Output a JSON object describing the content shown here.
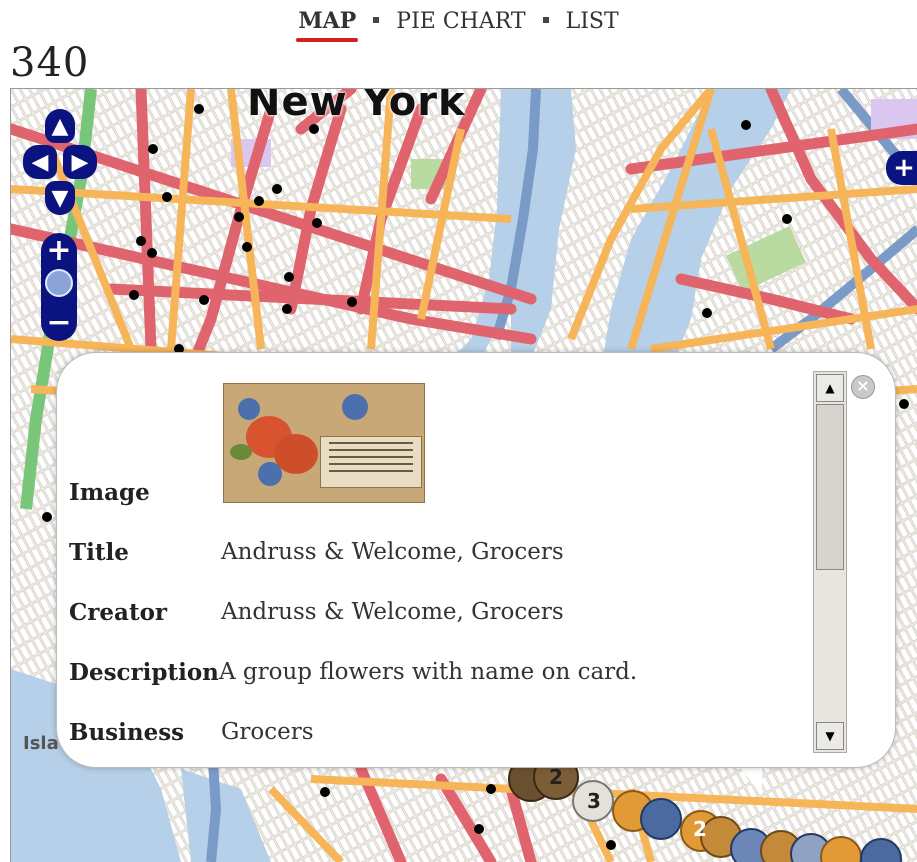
{
  "nav": {
    "items": [
      {
        "label": "MAP",
        "active": true
      },
      {
        "label": "PIE CHART",
        "active": false
      },
      {
        "label": "LIST",
        "active": false
      }
    ]
  },
  "result_count": "340",
  "map": {
    "city_label": "New York",
    "district_label": "Isla",
    "controls": {
      "pan_up_icon": "triangle-up",
      "pan_left_icon": "triangle-left",
      "pan_right_icon": "triangle-right",
      "pan_down_icon": "triangle-down",
      "zoom_in_label": "+",
      "zoom_out_label": "−",
      "layer_switch_label": "+"
    },
    "cluster_markers": [
      "2",
      "3",
      "2"
    ],
    "colors": {
      "water": "#b5d0e8",
      "major_road": "#e0646e",
      "arterial_road": "#f7b55a",
      "park": "#b9dba0",
      "highway": "#7a9bc8",
      "control": "#0a137f"
    }
  },
  "popup": {
    "close_icon": "close-x",
    "fields": [
      {
        "label": "Image",
        "value": ""
      },
      {
        "label": "Title",
        "value": "Andruss & Welcome, Grocers"
      },
      {
        "label": "Creator",
        "value": "Andruss & Welcome, Grocers"
      },
      {
        "label": "Description",
        "value": "A group flowers with name on card."
      },
      {
        "label": "Business",
        "value": "Grocers"
      }
    ],
    "image_alt": "trade card thumbnail with red and blue flowers"
  }
}
